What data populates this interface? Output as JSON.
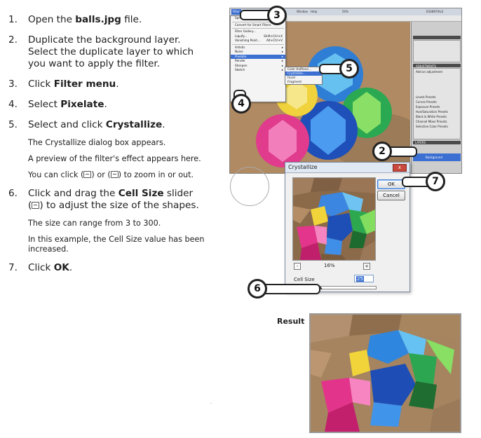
{
  "steps": [
    {
      "num": "1.",
      "pre": "Open the ",
      "bold": "balls.jpg",
      "post": " file."
    },
    {
      "num": "2.",
      "pre": "Duplicate the background layer. Select the duplicate layer to which you want to apply the filter.",
      "bold": "",
      "post": ""
    },
    {
      "num": "3.",
      "pre": "Click ",
      "bold": "Filter menu",
      "post": "."
    },
    {
      "num": "4.",
      "pre": "Select ",
      "bold": "Pixelate",
      "post": "."
    },
    {
      "num": "5.",
      "pre": "Select and click ",
      "bold": "Crystallize",
      "post": "."
    },
    {
      "num": "6.",
      "pre": "Click and drag the ",
      "bold": "Cell Size",
      "post": " slider",
      "line2": "to adjust the size of the shapes."
    },
    {
      "num": "7.",
      "pre": "Click ",
      "bold": "OK",
      "post": "."
    }
  ],
  "notes5": [
    "The Crystallize dialog box appears.",
    "A preview of the filter's effect appears here.",
    "You can click",
    "or",
    "to zoom in or out."
  ],
  "notes6": [
    "The size can range from 3 to 300.",
    "In this example, the Cell Size value has been increased."
  ],
  "menu": {
    "top_label": "Filter",
    "items": [
      {
        "label": "Spherize",
        "kbd": ""
      },
      {
        "label": "Convert for Smart Filters",
        "kbd": ""
      },
      {
        "label": "Filter Gallery...",
        "kbd": ""
      },
      {
        "label": "Liquify...",
        "kbd": "Shift+Ctrl+X"
      },
      {
        "label": "Vanishing Point...",
        "kbd": "Alt+Ctrl+V"
      },
      {
        "label": "Artistic",
        "kbd": ""
      },
      {
        "label": "Noise",
        "kbd": ""
      },
      {
        "label": "Pixelate",
        "kbd": ""
      },
      {
        "label": "Render",
        "kbd": ""
      },
      {
        "label": "Sharpen",
        "kbd": ""
      },
      {
        "label": "Sketch",
        "kbd": ""
      }
    ],
    "submenu": [
      "Color Halftone...",
      "Crystallize...",
      "Facet",
      "Fragment"
    ]
  },
  "topbar": {
    "menu_items": [
      "Window",
      "Help"
    ],
    "zoom": "50%",
    "workspace": "ESSENTIALS"
  },
  "right_panel": {
    "adjust_title": "ADJUSTMENTS",
    "adjust_sub": "Add an adjustment",
    "presets": [
      "Levels Presets",
      "Curves Presets",
      "Exposure Presets",
      "Hue/Saturation Presets",
      "Black & White Presets",
      "Channel Mixer Presets",
      "Selective Color Presets"
    ],
    "layers_tab": "LAYERS",
    "layer_name": "Background"
  },
  "dialog": {
    "title": "Crystallize",
    "close": "x",
    "ok": "OK",
    "cancel": "Cancel",
    "zoom_minus": "-",
    "zoom_plus": "+",
    "zoom": "16%",
    "cell_label": "Cell Size",
    "cell_value": "25",
    "slider_fraction": 0.04
  },
  "callouts": {
    "c2": "2",
    "c3": "3",
    "c4": "4",
    "c5": "5",
    "c6": "6",
    "c7": "7"
  },
  "result_label": "Result"
}
